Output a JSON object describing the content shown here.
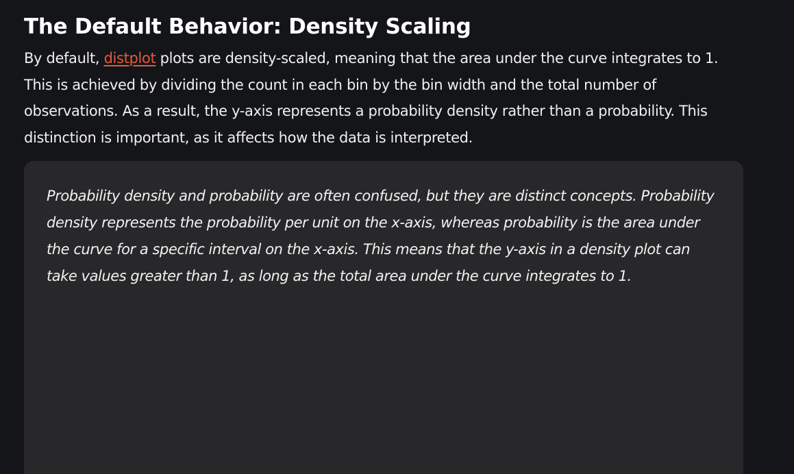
{
  "section": {
    "heading": "The Default Behavior: Density Scaling",
    "paragraph": {
      "before_link": "By default, ",
      "link_text": "distplot",
      "after_link": " plots are density-scaled, meaning that the area under the curve integrates to 1. This is achieved by dividing the count in each bin by the bin width and the total number of observations. As a result, the y-axis represents a probability density rather than a probability. This distinction is important, as it affects how the data is interpreted."
    },
    "callout": {
      "text": "Probability density and probability are often confused, but they are distinct concepts. Probability density represents the probability per unit on the x-axis, whereas probability is the area under the curve for a specific interval on the x-axis. This means that the y-axis in a density plot can take values greater than 1, as long as the total area under the curve integrates to 1."
    }
  },
  "colors": {
    "background": "#141518",
    "text": "#f0f0f0",
    "link": "#e45b3c",
    "callout_background": "#28282a"
  }
}
